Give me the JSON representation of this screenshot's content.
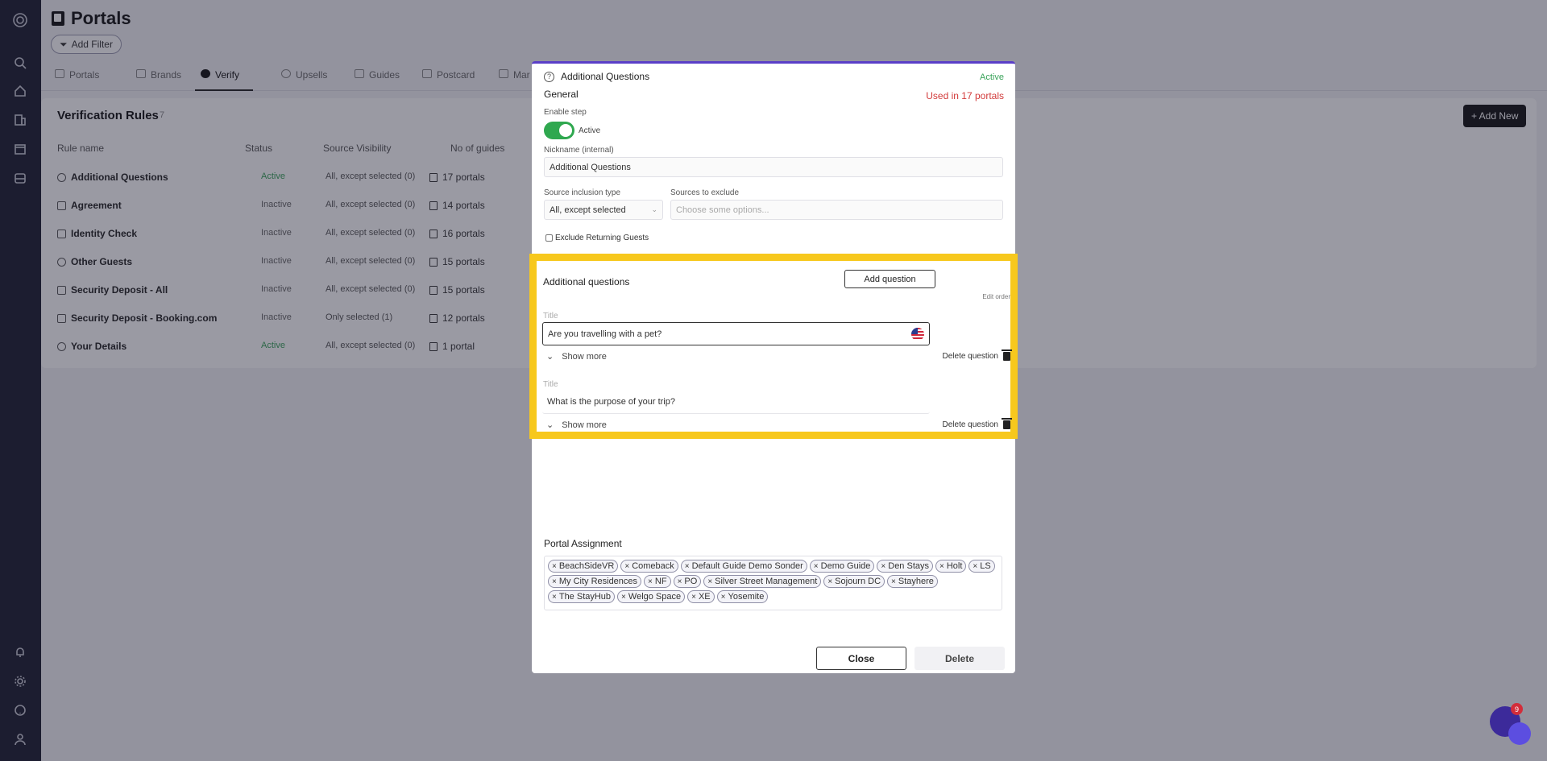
{
  "page": {
    "title": "Portals",
    "add_filter": "Add Filter"
  },
  "tabs": [
    {
      "label": "Portals"
    },
    {
      "label": "Brands"
    },
    {
      "label": "Verify"
    },
    {
      "label": "Upsells"
    },
    {
      "label": "Guides"
    },
    {
      "label": "Postcard"
    },
    {
      "label": "Mar"
    }
  ],
  "rules": {
    "title": "Verification Rules",
    "count": "7",
    "add_new": "+ Add New",
    "columns": {
      "name": "Rule name",
      "status": "Status",
      "visibility": "Source Visibility",
      "guides": "No of guides"
    },
    "rows": [
      {
        "name": "Additional Questions",
        "status": "Active",
        "visibility": "All, except selected (0)",
        "guides": "17 portals"
      },
      {
        "name": "Agreement",
        "status": "Inactive",
        "visibility": "All, except selected (0)",
        "guides": "14 portals"
      },
      {
        "name": "Identity Check",
        "status": "Inactive",
        "visibility": "All, except selected (0)",
        "guides": "16 portals"
      },
      {
        "name": "Other Guests",
        "status": "Inactive",
        "visibility": "All, except selected (0)",
        "guides": "15 portals"
      },
      {
        "name": "Security Deposit - All",
        "status": "Inactive",
        "visibility": "All, except selected (0)",
        "guides": "15 portals"
      },
      {
        "name": "Security Deposit - Booking.com",
        "status": "Inactive",
        "visibility": "Only selected (1)",
        "guides": "12 portals"
      },
      {
        "name": "Your Details",
        "status": "Active",
        "visibility": "All, except selected (0)",
        "guides": "1 portal"
      }
    ]
  },
  "modal": {
    "title": "Additional Questions",
    "status": "Active",
    "general": "General",
    "used_in": "Used in 17 portals",
    "enable_step_label": "Enable step",
    "toggle_label": "Active",
    "nickname_label": "Nickname (internal)",
    "nickname_value": "Additional Questions",
    "source_type_label": "Source inclusion type",
    "source_type_value": "All, except selected",
    "sources_exclude_label": "Sources to exclude",
    "sources_exclude_placeholder": "Choose some options...",
    "exclude_returning": "Exclude Returning Guests",
    "additional_questions": {
      "heading": "Additional questions",
      "add_question": "Add question",
      "edit_order": "Edit order",
      "questions": [
        {
          "label": "Title",
          "value": "Are you travelling with a pet?",
          "show_more": "Show more",
          "delete": "Delete question"
        },
        {
          "label": "Title",
          "value": "What is the purpose of your trip?",
          "show_more": "Show more",
          "delete": "Delete question"
        }
      ]
    },
    "portal_assignment": {
      "title": "Portal Assignment",
      "chips": [
        "BeachSideVR",
        "Comeback",
        "Default Guide Demo Sonder",
        "Demo Guide",
        "Den Stays",
        "Holt",
        "LS",
        "My City Residences",
        "NF",
        "PO",
        "Silver Street Management",
        "Sojourn DC",
        "Stayhere",
        "The StayHub",
        "Welgo Space",
        "XE",
        "Yosemite"
      ]
    },
    "close": "Close",
    "delete": "Delete"
  },
  "chat": {
    "badge": "9"
  },
  "colors": {
    "active": "#3aa35a",
    "used": "#d23b3b",
    "highlight": "#f7c81d",
    "toggle": "#2fa84f"
  }
}
